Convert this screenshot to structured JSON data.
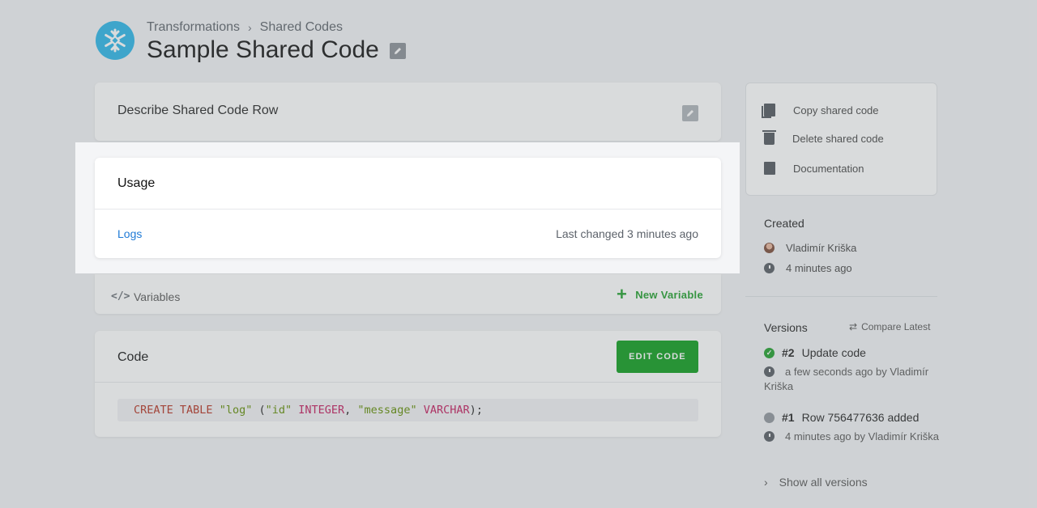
{
  "breadcrumb": {
    "items": [
      "Transformations",
      "Shared Codes"
    ]
  },
  "page_title": "Sample Shared Code",
  "describe": {
    "title": "Describe Shared Code Row"
  },
  "usage": {
    "title": "Usage",
    "logs_label": "Logs",
    "last_changed": "Last changed 3 minutes ago"
  },
  "variables": {
    "label": "Variables",
    "new_label": "New Variable"
  },
  "code": {
    "title": "Code",
    "edit_label": "EDIT CODE",
    "tokens": {
      "kw1": "CREATE TABLE",
      "tbl": "\"log\"",
      "p1": " (",
      "col1": "\"id\"",
      "typ1": "INTEGER",
      "comma": ", ",
      "col2": "\"message\"",
      "typ2": "VARCHAR",
      "end": ");"
    }
  },
  "actions": {
    "items": [
      {
        "label": "Copy shared code",
        "icon": "copy-icon"
      },
      {
        "label": "Delete shared code",
        "icon": "trash-icon"
      },
      {
        "label": "Documentation",
        "icon": "document-icon"
      }
    ]
  },
  "created": {
    "title": "Created",
    "author": "Vladimír Kriška",
    "time": "4 minutes ago"
  },
  "versions": {
    "title": "Versions",
    "compare_label": "Compare Latest",
    "list": [
      {
        "number": "#2",
        "title": "Update code",
        "meta": "a few seconds ago by Vladimír Kriška",
        "status": "success"
      },
      {
        "number": "#1",
        "title": "Row 756477636 added",
        "meta": "4 minutes ago by Vladimír Kriška",
        "status": "neutral"
      }
    ],
    "show_all_label": "Show all versions"
  },
  "colors": {
    "accent_green": "#0b9c19",
    "link_blue": "#1f7ad6",
    "brand_blue": "#29b5e8"
  }
}
